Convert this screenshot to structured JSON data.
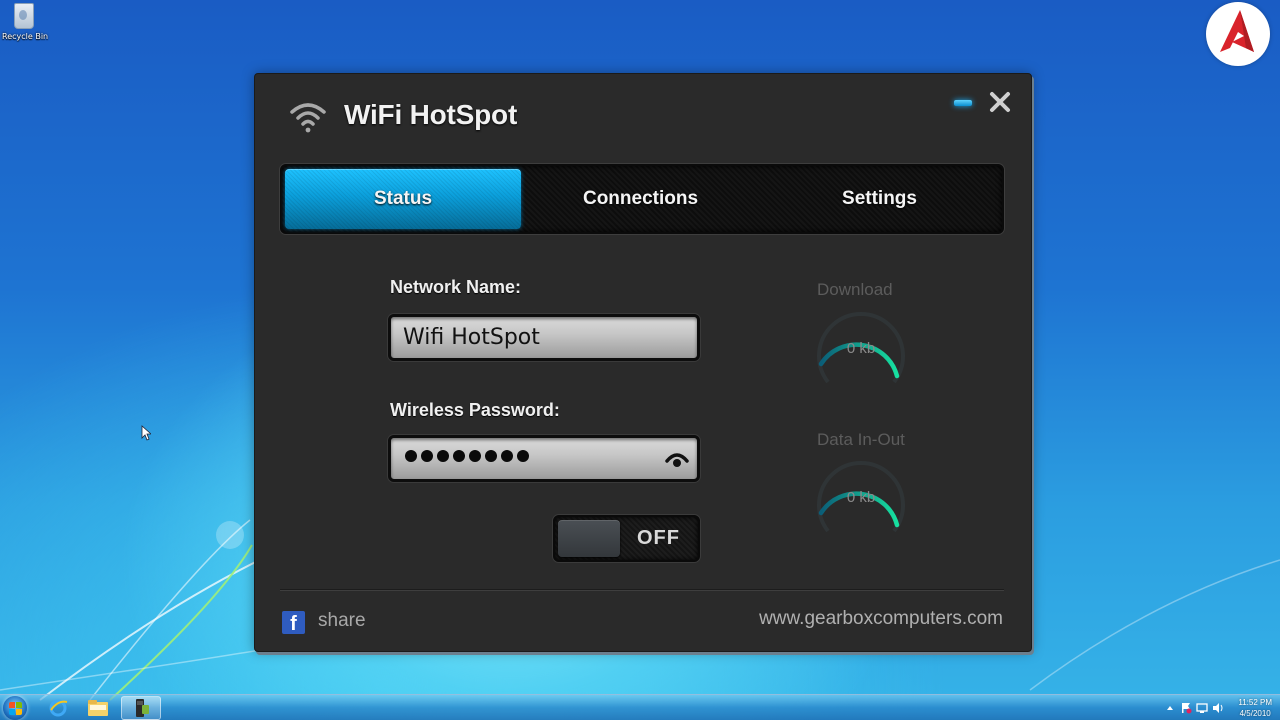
{
  "desktop": {
    "icons": [
      {
        "label": "Recycle Bin",
        "icon": "recycle-bin-icon"
      }
    ],
    "brand_logo": "red-a-logo-icon"
  },
  "window": {
    "title": "WiFi HotSpot",
    "title_icon": "wifi-icon",
    "controls": {
      "minimize": "minimize-icon",
      "close": "close-icon"
    },
    "accent_color": "#0ba4e0",
    "tabs": [
      {
        "label": "Status",
        "active": true
      },
      {
        "label": "Connections",
        "active": false
      },
      {
        "label": "Settings",
        "active": false
      }
    ],
    "form": {
      "network_name_label": "Network Name:",
      "network_name_value": "Wifi HotSpot",
      "password_label": "Wireless Password:",
      "password_length": 8,
      "password_reveal_icon": "eye-icon",
      "toggle_label": "OFF",
      "toggle_state": "off"
    },
    "gauges": [
      {
        "title": "Download",
        "value": "0 kb"
      },
      {
        "title": "Data In-Out",
        "value": "0 kb"
      }
    ],
    "footer": {
      "share_icon": "facebook-icon",
      "share_label": "share",
      "website": "www.gearboxcomputers.com"
    }
  },
  "taskbar": {
    "start": "windows-start-icon",
    "pinned": [
      {
        "name": "internet-explorer-icon",
        "active": false
      },
      {
        "name": "file-explorer-icon",
        "active": false
      },
      {
        "name": "hotspot-app-icon",
        "active": true
      }
    ],
    "tray": {
      "icons": [
        "show-hidden-icons-icon",
        "action-center-icon",
        "network-icon",
        "volume-icon"
      ],
      "time": "11:52 PM",
      "date": "4/5/2010"
    }
  }
}
